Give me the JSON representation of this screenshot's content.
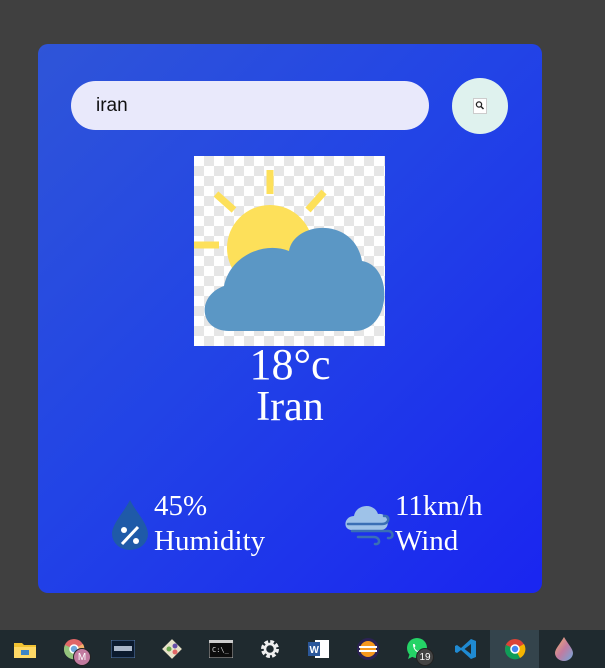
{
  "search": {
    "value": "iran",
    "button_icon": "search-icon"
  },
  "weather": {
    "icon": "partly-cloudy-icon",
    "temperature": "18°c",
    "city": "Iran",
    "humidity_value": "45%",
    "humidity_label": "Humidity",
    "wind_value": "11km/h",
    "wind_label": "Wind"
  },
  "colors": {
    "card_start": "#2f55d8",
    "card_end": "#1a25f0",
    "page_bg": "#404040",
    "taskbar": "#1f2a2f"
  },
  "taskbar": {
    "items": [
      {
        "name": "file-explorer-icon"
      },
      {
        "name": "chrome-profile-icon",
        "badge": "M"
      },
      {
        "name": "mysql-workbench-icon"
      },
      {
        "name": "git-icon"
      },
      {
        "name": "terminal-icon"
      },
      {
        "name": "settings-icon"
      },
      {
        "name": "word-icon"
      },
      {
        "name": "eclipse-icon"
      },
      {
        "name": "whatsapp-icon",
        "badge": "19"
      },
      {
        "name": "vscode-icon"
      },
      {
        "name": "chrome-icon"
      },
      {
        "name": "paint-drop-icon"
      }
    ]
  }
}
